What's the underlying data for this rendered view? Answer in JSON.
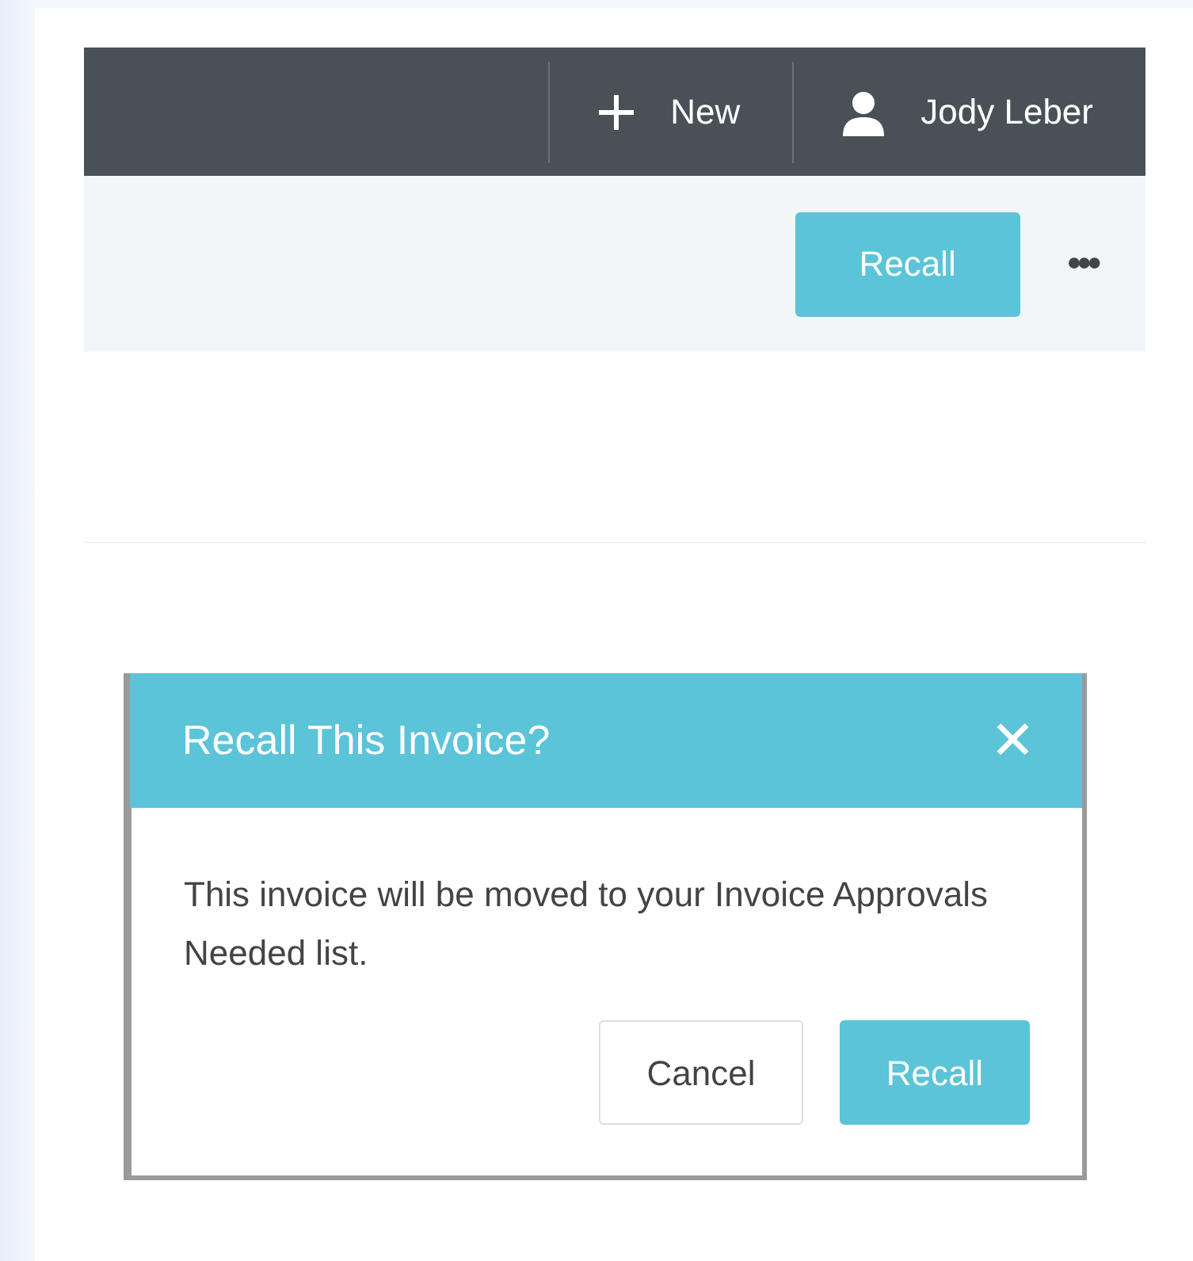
{
  "header": {
    "new_label": "New",
    "user_name": "Jody Leber"
  },
  "toolbar": {
    "recall_button": "Recall",
    "more_button": "•••"
  },
  "dialog": {
    "title": "Recall This Invoice?",
    "close": "✕",
    "message": "This invoice will be moved to your Invoice Approvals Needed list.",
    "buttons": [
      {
        "label": "Cancel",
        "kind": "secondary"
      },
      {
        "label": "Recall",
        "kind": "primary"
      }
    ]
  }
}
